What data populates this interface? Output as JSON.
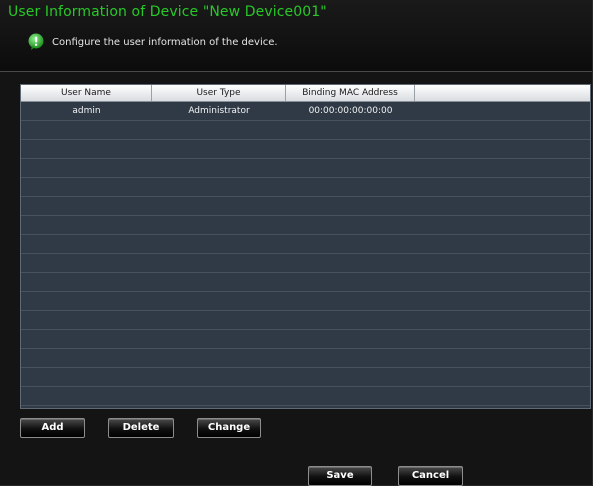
{
  "dialog": {
    "title": "User Information of Device \"New Device001\"",
    "subtitle": "Configure the user information of the device."
  },
  "table": {
    "columns": [
      "User Name",
      "User Type",
      "Binding MAC Address"
    ],
    "rows": [
      [
        "admin",
        "Administrator",
        "00:00:00:00:00:00"
      ]
    ],
    "empty_rows": 15
  },
  "buttons": {
    "add": "Add",
    "delete": "Delete",
    "change": "Change",
    "save": "Save",
    "cancel": "Cancel"
  },
  "colors": {
    "title": "#28c828",
    "icon": "#3fb63f",
    "grid_background": "#2f3a46"
  },
  "icons": {
    "subtitle_icon": "info-icon"
  }
}
